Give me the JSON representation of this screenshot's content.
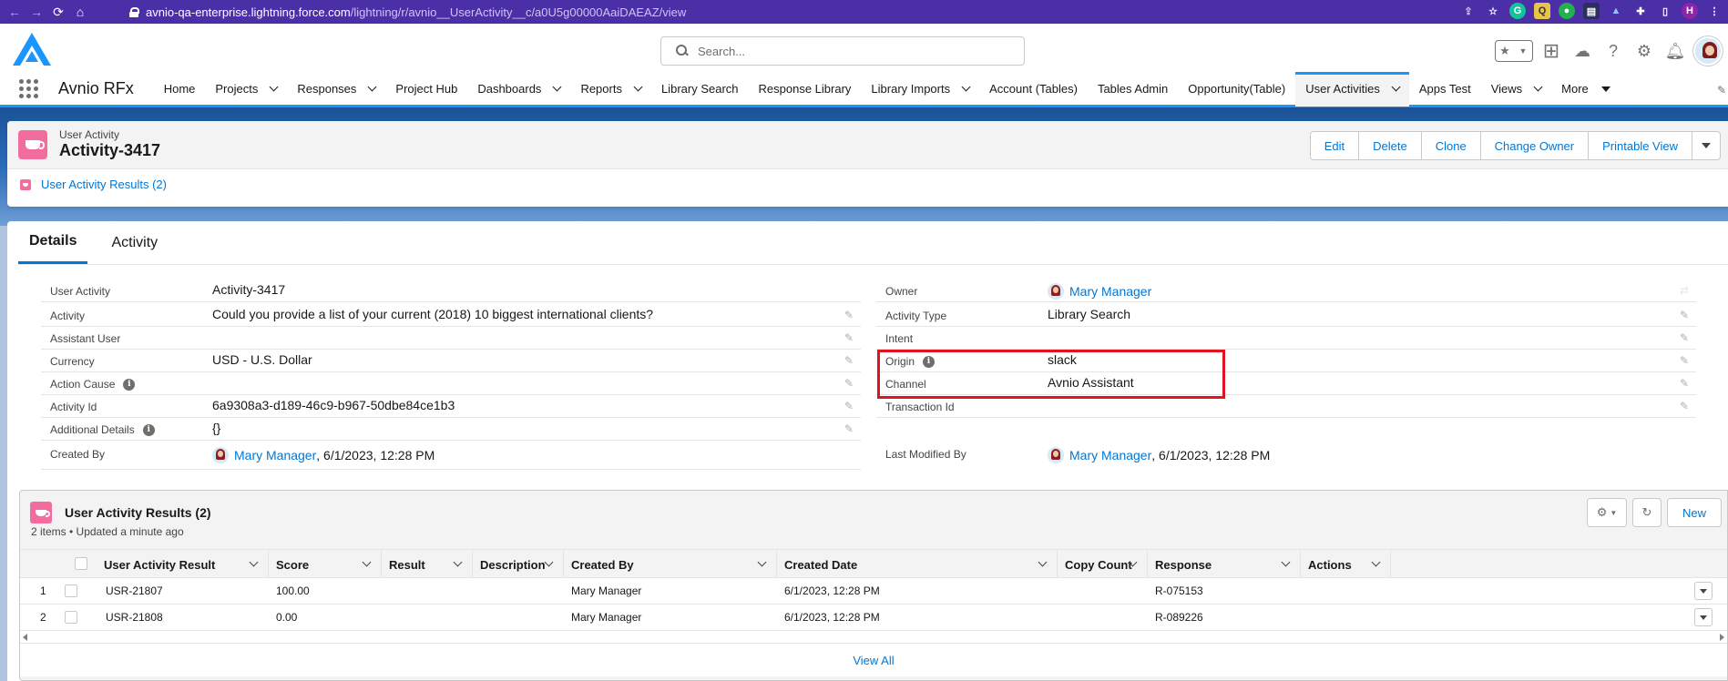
{
  "browser": {
    "url_host": "avnio-qa-enterprise.lightning.force.com",
    "url_path": "/lightning/r/avnio__UserActivity__c/a0U5g00000AaiDAEAZ/view",
    "profile_initial": "H"
  },
  "header": {
    "search_placeholder": "Search..."
  },
  "nav": {
    "app_name": "Avnio RFx",
    "items": [
      {
        "label": "Home",
        "dropdown": false
      },
      {
        "label": "Projects",
        "dropdown": true
      },
      {
        "label": "Responses",
        "dropdown": true
      },
      {
        "label": "Project Hub",
        "dropdown": false
      },
      {
        "label": "Dashboards",
        "dropdown": true
      },
      {
        "label": "Reports",
        "dropdown": true
      },
      {
        "label": "Library Search",
        "dropdown": false
      },
      {
        "label": "Response Library",
        "dropdown": false
      },
      {
        "label": "Library Imports",
        "dropdown": true
      },
      {
        "label": "Account (Tables)",
        "dropdown": false
      },
      {
        "label": "Tables Admin",
        "dropdown": false
      },
      {
        "label": "Opportunity(Table)",
        "dropdown": false
      },
      {
        "label": "User Activities",
        "dropdown": true,
        "active": true
      },
      {
        "label": "Apps Test",
        "dropdown": false
      },
      {
        "label": "Views",
        "dropdown": true
      },
      {
        "label": "More",
        "dropdown": true
      }
    ]
  },
  "record": {
    "object_type": "User Activity",
    "title": "Activity-3417",
    "actions": [
      "Edit",
      "Delete",
      "Clone",
      "Change Owner",
      "Printable View"
    ],
    "related_link": "User Activity Results (2)"
  },
  "tabs": [
    "Details",
    "Activity"
  ],
  "fields_left": [
    {
      "label": "User Activity",
      "value": "Activity-3417"
    },
    {
      "label": "Activity",
      "value": "Could you provide a list of your current (2018) 10 biggest international clients?"
    },
    {
      "label": "Assistant User",
      "value": ""
    },
    {
      "label": "Currency",
      "value": "USD - U.S. Dollar"
    },
    {
      "label": "Action Cause",
      "value": ""
    },
    {
      "label": "Activity Id",
      "value": "6a9308a3-d189-46c9-b967-50dbe84ce1b3"
    },
    {
      "label": "Additional Details",
      "value": "{}"
    },
    {
      "label": "Created By",
      "user": "Mary Manager",
      "date": ", 6/1/2023, 12:28 PM"
    }
  ],
  "fields_right": [
    {
      "label": "Owner",
      "user": "Mary Manager"
    },
    {
      "label": "Activity Type",
      "value": "Library Search"
    },
    {
      "label": "Intent",
      "value": ""
    },
    {
      "label": "Origin",
      "value": "slack"
    },
    {
      "label": "Channel",
      "value": "Avnio Assistant"
    },
    {
      "label": "Transaction Id",
      "value": ""
    },
    {
      "label": "Last Modified By",
      "user": "Mary Manager",
      "date": ", 6/1/2023, 12:28 PM"
    }
  ],
  "related_list": {
    "title": "User Activity Results (2)",
    "subtitle": "2 items • Updated a minute ago",
    "new_label": "New",
    "columns": [
      "User Activity Result",
      "Score",
      "Result",
      "Description",
      "Created By",
      "Created Date",
      "Copy Count",
      "Response",
      "Actions"
    ],
    "rows": [
      {
        "num": "1",
        "name": "USR-21807",
        "score": "100.00",
        "created_by": "Mary Manager",
        "created_date": "6/1/2023, 12:28 PM",
        "response": "R-075153"
      },
      {
        "num": "2",
        "name": "USR-21808",
        "score": "0.00",
        "created_by": "Mary Manager",
        "created_date": "6/1/2023, 12:28 PM",
        "response": "R-089226"
      }
    ],
    "view_all": "View All"
  },
  "colors": {
    "brand": "#0176d3",
    "browser_bar": "#4b2fa6",
    "object_icon": "#f06d9d",
    "highlight_box": "#e0141e"
  }
}
